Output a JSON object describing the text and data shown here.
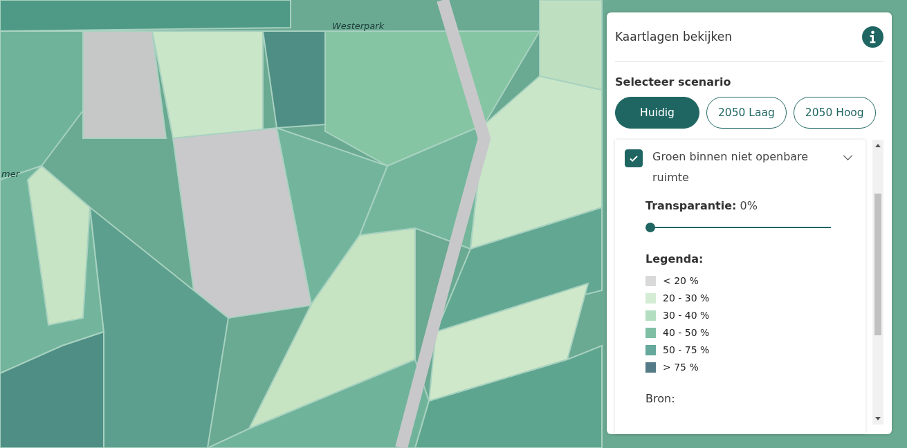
{
  "map_labels": [
    {
      "text": "Westerpark"
    },
    {
      "text": "mer"
    }
  ],
  "panel": {
    "title": "Kaartlagen bekijken",
    "scenario_heading": "Selecteer scenario",
    "scenarios": [
      {
        "label": "Huidig",
        "selected": true
      },
      {
        "label": "2050 Laag",
        "selected": false
      },
      {
        "label": "2050 Hoog",
        "selected": false
      }
    ],
    "layer": {
      "name": "Groen binnen niet openbare ruimte",
      "checked": true,
      "expanded": true,
      "transparency_label": "Transparantie:",
      "transparency_value": "0%",
      "level": 0,
      "legend_title": "Legenda:",
      "legend": [
        {
          "label": "< 20 %",
          "color": "#d9d9d9"
        },
        {
          "label": "20 - 30 %",
          "color": "#d4ecd4"
        },
        {
          "label": "30 - 40 %",
          "color": "#b3dfc0"
        },
        {
          "label": "40 - 50 %",
          "color": "#7fbfa3"
        },
        {
          "label": "50 - 75 %",
          "color": "#66a89b"
        },
        {
          "label": "> 75 %",
          "color": "#557a88"
        }
      ],
      "source_label": "Bron:"
    }
  }
}
